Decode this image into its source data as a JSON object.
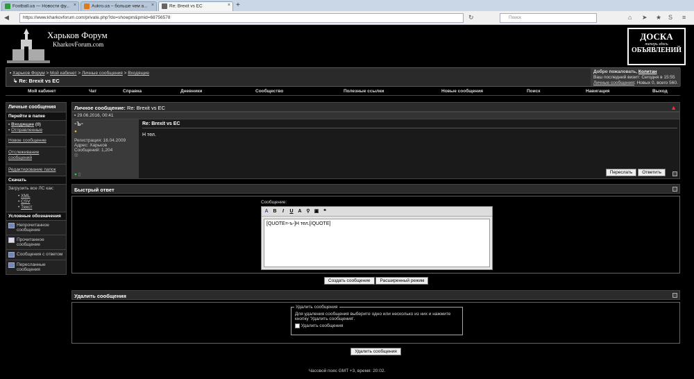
{
  "browser": {
    "tabs": [
      {
        "label": "Football.ua — Новости фу...",
        "color": "#2e9e3a"
      },
      {
        "label": "Aukro.ua – больше чем а...",
        "color": "#e07a18"
      },
      {
        "label": "Re: Brexit vs EC",
        "color": "#666666"
      }
    ],
    "url": "https://www.kharkovforum.com/private.php?do=showpm&pmid=68756578",
    "search_placeholder": "Поиск"
  },
  "header": {
    "title": "Харьков Форум",
    "subtitle": "KharkovForum.com",
    "board_line1": "ДОСКА",
    "board_line2": "теперь здесь",
    "board_line3": "ОБЪЯВЛЕНИЙ"
  },
  "breadcrumb": {
    "home": "Харьков Форум",
    "cabinet": "Мой кабинет",
    "pm": "Личные сообщения",
    "inbox": "Входящие",
    "current": "Re: Brexit vs EC"
  },
  "welcome": {
    "greet": "Добро пожаловать,",
    "user": "Колитан",
    "last": "Ваш последний визит: Сегодня в 15:55",
    "pm_link": "Личные сообщения",
    "pm_rest": ": Новых 0, всего 560."
  },
  "menu": [
    "Мой кабинет",
    "Чат",
    "Справка",
    "Дневники",
    "Сообщество",
    "Полезные ссылки",
    "Новые сообщения",
    "Поиск",
    "Навигация",
    "Выход"
  ],
  "sidebar": {
    "title": "Личные сообщения",
    "goto": "Перейти в папке",
    "inbox": "Входящие",
    "inbox_count": "(0)",
    "sent": "Отправленные",
    "new_msg": "Новое сообщение",
    "track": "Отслеживание сообщений",
    "edit": "Редактирование папок",
    "download": "Скачать",
    "download_all": "Загрузить все ЛС как:",
    "xml": "XML",
    "csv": "CSV",
    "text": "Текст",
    "legend_title": "Условные обозначения",
    "legend": [
      "Непрочитанное сообщение",
      "Прочитанное сообщение",
      "Сообщения с ответом",
      "Пересланные сообщения"
    ]
  },
  "pm": {
    "label": "Личное сообщение:",
    "title": "Re: Brexit vs EC",
    "date": "29.06.2016, 00:41",
    "user": "-ъ-",
    "reg": "Регистрация: 16.04.2009",
    "addr": "Адрес: Харьков",
    "msgs": "Сообщений: 1,204",
    "msg_title": "Re: Brexit vs EC",
    "body": "Н тел.",
    "forward": "Переслать",
    "reply": "Ответить"
  },
  "quick": {
    "title": "Быстрый ответ",
    "label": "Сообщение:",
    "text": "[QUOTE=-ъ-]Н тел.[/QUOTE]",
    "submit": "Создать сообщение",
    "advanced": "Расширенный режим"
  },
  "del": {
    "title": "Удалить сообщения",
    "legend": "Удалить сообщения",
    "desc": "Для удаления сообщения выберите одно или несколько из них и нажмите кнопку 'Удалить сообщения'.",
    "check": "Удалить сообщения",
    "button": "Удалить сообщения"
  },
  "footer": "Часовой пояс GMT +3, время: 20:02."
}
